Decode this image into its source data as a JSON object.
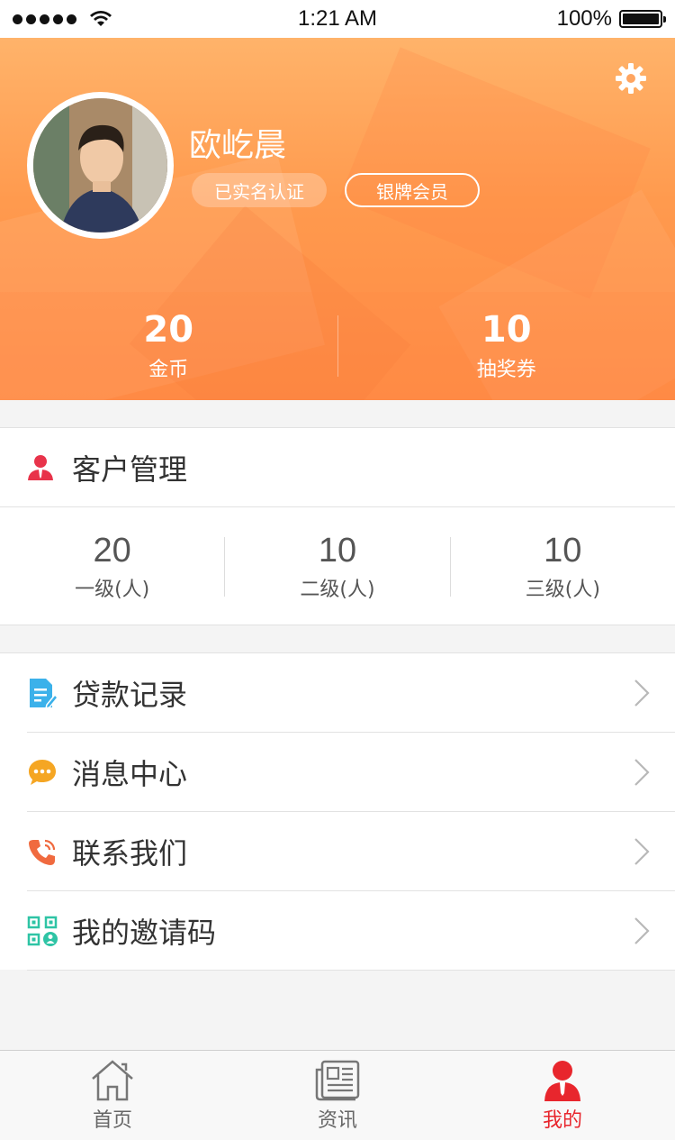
{
  "status_bar": {
    "time": "1:21 AM",
    "battery": "100%"
  },
  "profile": {
    "name": "欧屹晨",
    "badges": [
      "已实名认证",
      "银牌会员"
    ],
    "stats": [
      {
        "value": "20",
        "label": "金币"
      },
      {
        "value": "10",
        "label": "抽奖券"
      }
    ]
  },
  "customers": {
    "title": "客户管理",
    "levels": [
      {
        "value": "20",
        "label": "一级(人)"
      },
      {
        "value": "10",
        "label": "二级(人)"
      },
      {
        "value": "10",
        "label": "三级(人)"
      }
    ]
  },
  "menu": {
    "items": [
      {
        "label": "贷款记录",
        "icon": "document-edit-icon",
        "color": "#3bb1ea"
      },
      {
        "label": "消息中心",
        "icon": "chat-bubble-icon",
        "color": "#f5a623"
      },
      {
        "label": "联系我们",
        "icon": "phone-icon",
        "color": "#f06a3f"
      },
      {
        "label": "我的邀请码",
        "icon": "qr-code-icon",
        "color": "#2ec4a5"
      }
    ]
  },
  "tabbar": {
    "tabs": [
      {
        "label": "首页",
        "icon": "home-icon"
      },
      {
        "label": "资讯",
        "icon": "newspaper-icon"
      },
      {
        "label": "我的",
        "icon": "user-icon",
        "active": true
      }
    ],
    "active_color": "#e8262d"
  }
}
